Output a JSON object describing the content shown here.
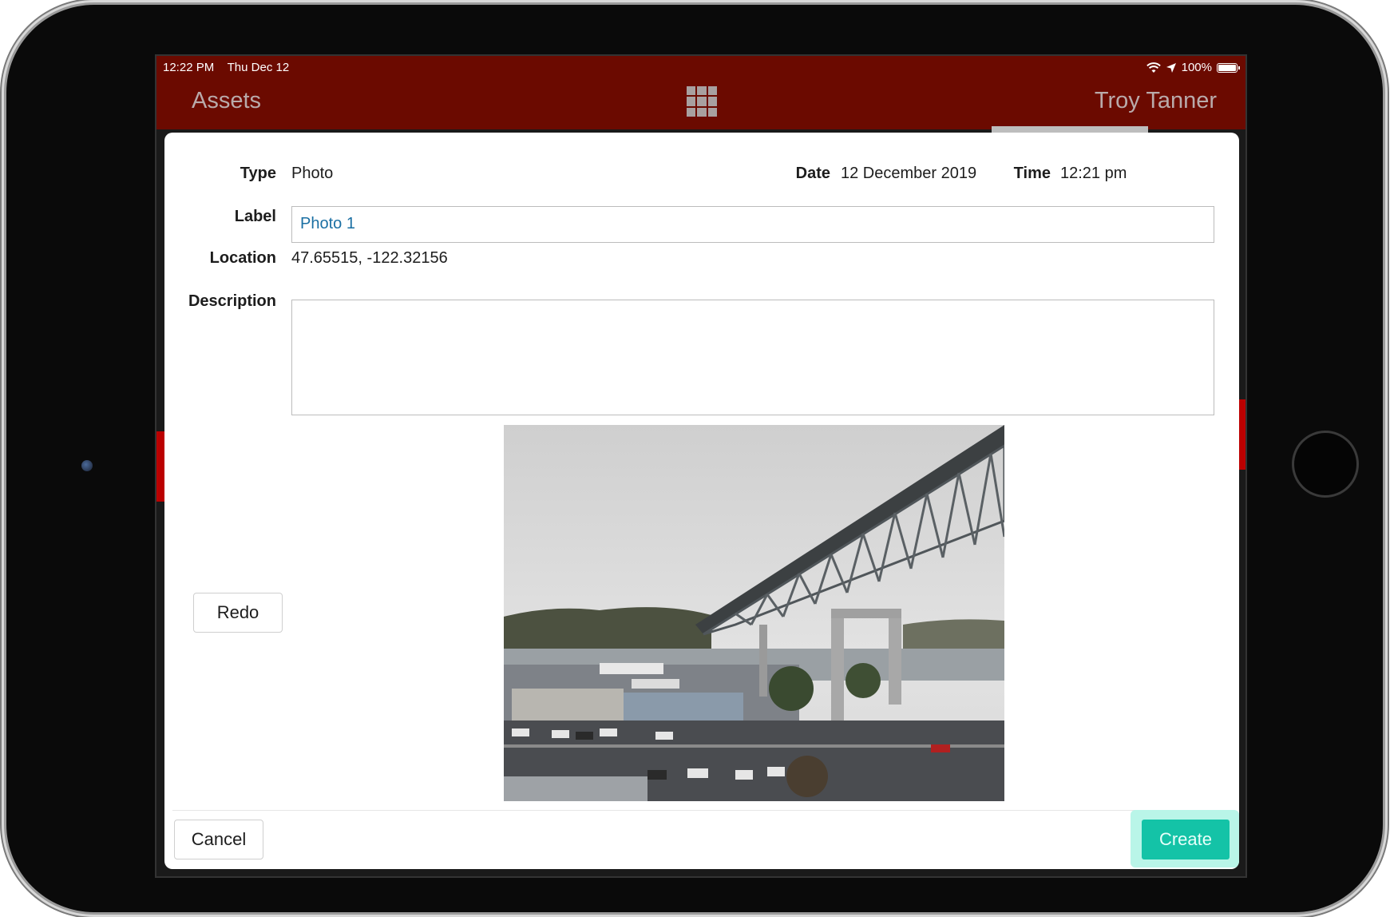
{
  "status_bar": {
    "time": "12:22 PM",
    "date": "Thu Dec 12",
    "battery": "100%"
  },
  "nav": {
    "left_title": "Assets",
    "right_title": "Troy Tanner",
    "center_icon": "grid-icon"
  },
  "form": {
    "type_label": "Type",
    "type_value": "Photo",
    "date_label": "Date",
    "date_value": "12 December 2019",
    "time_label": "Time",
    "time_value": "12:21 pm",
    "label_label": "Label",
    "label_value": "Photo 1",
    "location_label": "Location",
    "location_value": "47.65515, -122.32156",
    "description_label": "Description",
    "description_value": ""
  },
  "buttons": {
    "redo": "Redo",
    "cancel": "Cancel",
    "create": "Create"
  },
  "colors": {
    "topbar": "#6b0a00",
    "create": "#14c3a7",
    "create_highlight": "#b9f5e8",
    "label_text": "#1a6fa3"
  }
}
